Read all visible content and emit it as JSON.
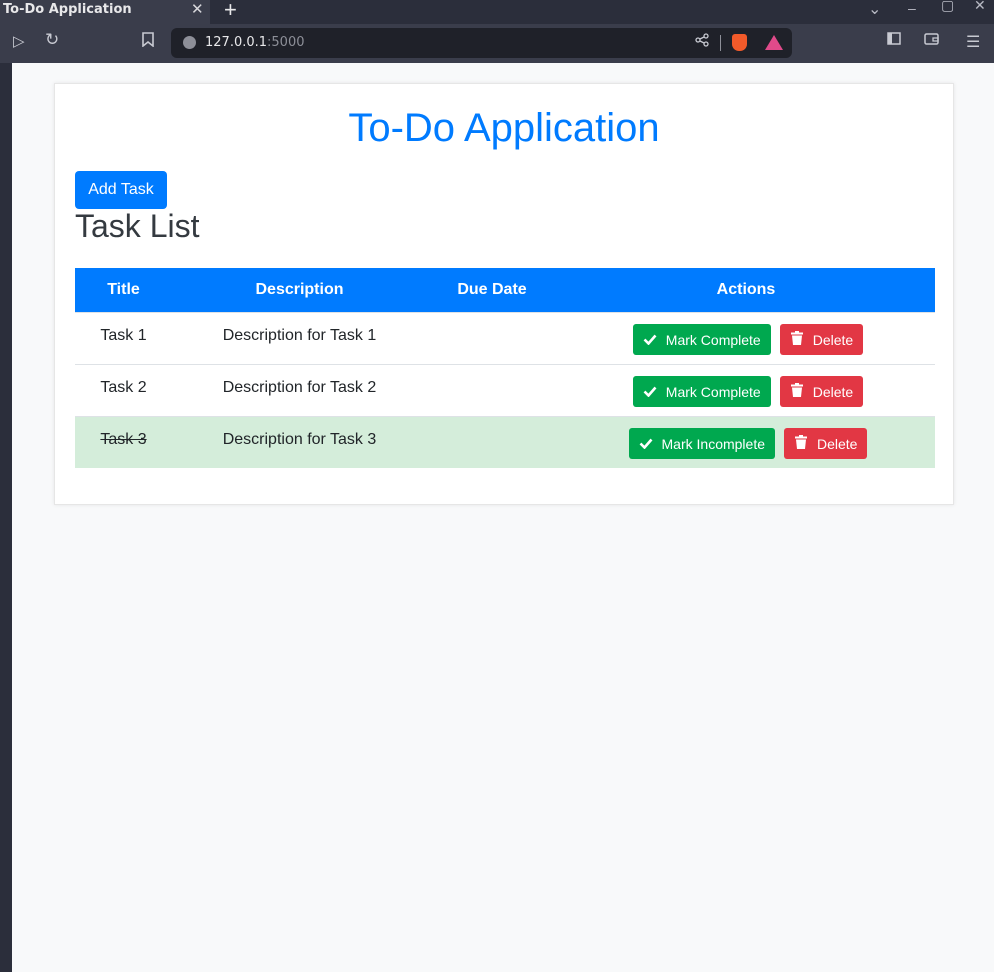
{
  "browser": {
    "tab_title": "To-Do Application",
    "tab_close": "✕",
    "new_tab": "+",
    "url_host": "127.0.0.1",
    "url_port": ":5000",
    "window_controls": [
      "⌄",
      "–",
      "▢",
      "✕"
    ]
  },
  "app": {
    "title": "To-Do Application",
    "add_button": "Add Task",
    "list_title": "Task List"
  },
  "table": {
    "headers": [
      "Title",
      "Description",
      "Due Date",
      "Actions"
    ],
    "rows": [
      {
        "title": "Task 1",
        "description": "Description for Task 1",
        "due_date": "",
        "toggle_label": "Mark Complete",
        "delete_label": "Delete",
        "completed": false
      },
      {
        "title": "Task 2",
        "description": "Description for Task 2",
        "due_date": "",
        "toggle_label": "Mark Complete",
        "delete_label": "Delete",
        "completed": false
      },
      {
        "title": "Task 3",
        "description": "Description for Task 3",
        "due_date": "",
        "toggle_label": "Mark Incomplete",
        "delete_label": "Delete",
        "completed": true
      }
    ]
  },
  "colors": {
    "primary": "#007bff",
    "success": "#00a84f",
    "danger": "#e23744",
    "completed_row": "#d4edda"
  },
  "icons": {
    "check": "check-icon",
    "trash": "trash-icon"
  }
}
